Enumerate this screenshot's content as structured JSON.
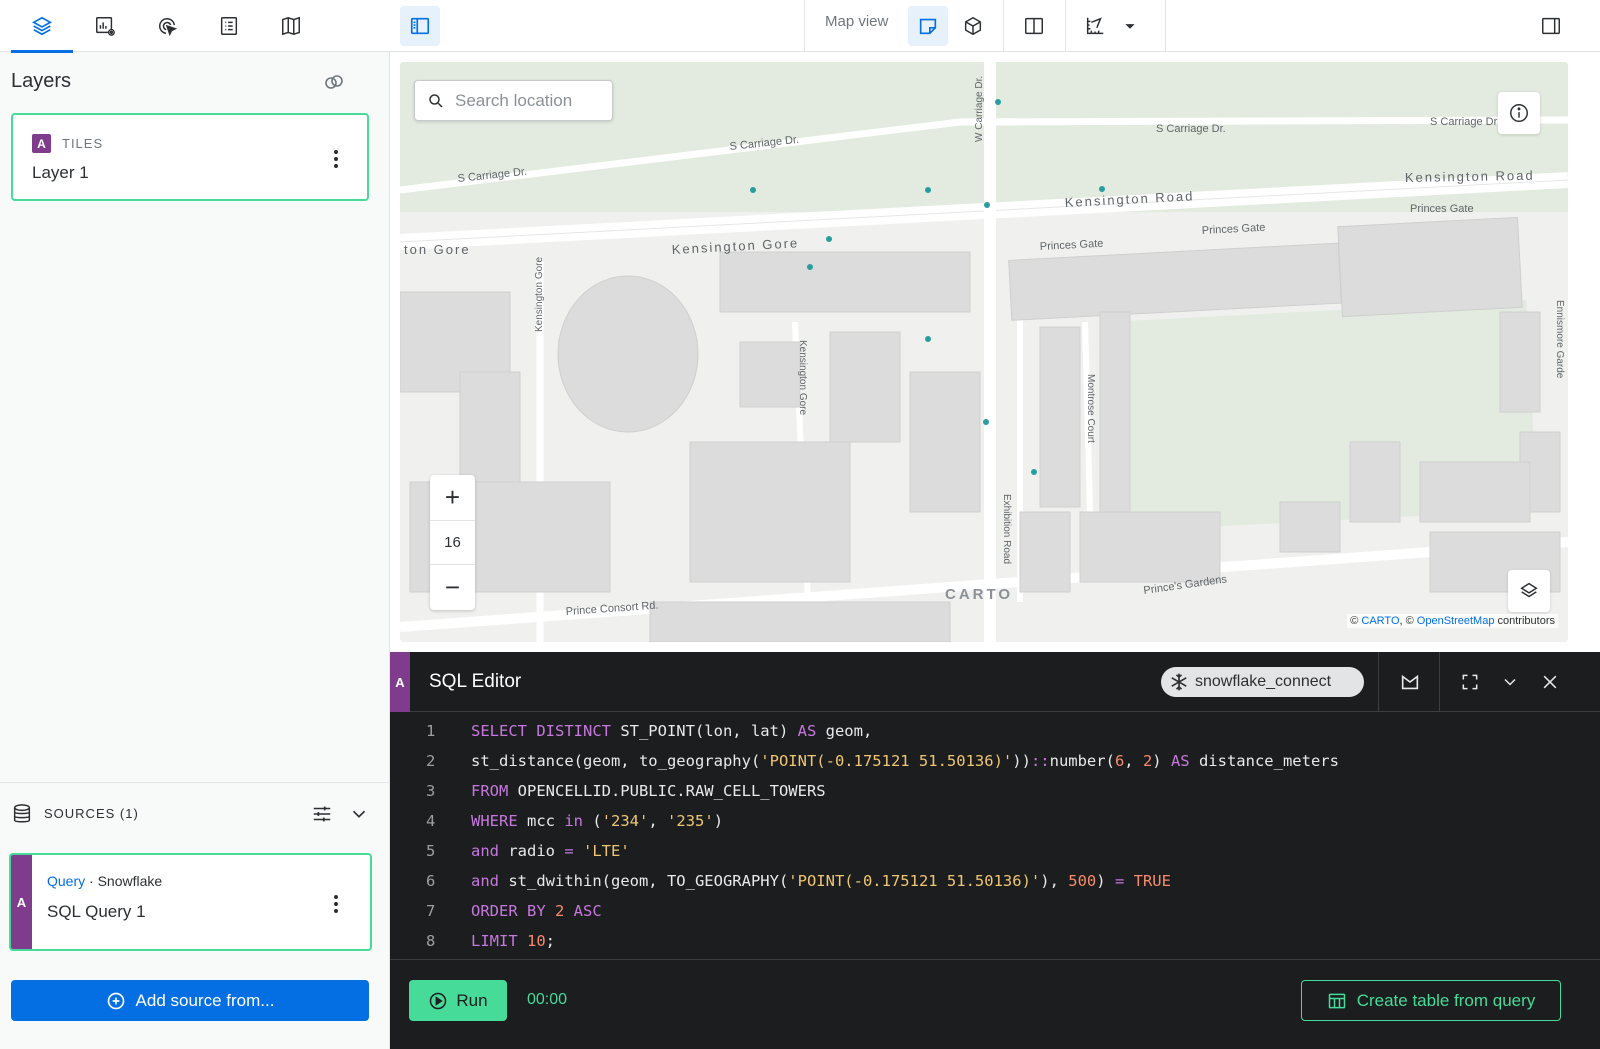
{
  "left_tabs": [
    {
      "icon": "layers-icon",
      "active": true
    },
    {
      "icon": "widgets-icon",
      "active": false
    },
    {
      "icon": "interactions-icon",
      "active": false
    },
    {
      "icon": "legend-icon",
      "active": false
    },
    {
      "icon": "basemap-icon",
      "active": false
    }
  ],
  "layers": {
    "title": "Layers",
    "items": [
      {
        "badge": "A",
        "type": "TILES",
        "name": "Layer 1"
      }
    ]
  },
  "sources": {
    "label": "SOURCES (1)",
    "items": [
      {
        "badge": "A",
        "kind": "Query",
        "separator": "·",
        "provider": "Snowflake",
        "name": "SQL Query 1"
      }
    ],
    "add_label": "Add source from..."
  },
  "toolbar": {
    "map_view_label": "Map view"
  },
  "map": {
    "search_placeholder": "Search location",
    "zoom_level": "16",
    "zoom_in": "+",
    "zoom_out": "−",
    "carto_logo": "CARTO",
    "attribution_prefix": "©",
    "attribution_carto": "CARTO",
    "attribution_sep": ", ©",
    "attribution_osm": "OpenStreetMap",
    "attribution_suffix": "contributors",
    "street_labels": {
      "kensington_road": "Kensington Road",
      "kensington_gore": "Kensington Gore",
      "kensington_gore_left": "ton Gore",
      "s_carriage_1": "S Carriage Dr.",
      "s_carriage_2": "S Carriage Dr.",
      "s_carriage_3": "S Carriage Dr.",
      "s_carriage_4": "S Carriage Dr",
      "w_carriage": "W Carriage Dr.",
      "princes_gate_1": "Princes Gate",
      "princes_gate_2": "Princes Gate",
      "princes_gate_3": "Princes Gate",
      "kensington_gore_v1": "Kensington Gore",
      "kensington_gore_v2": "Kensington Gore",
      "montrose": "Montrose Court",
      "exhibition": "Exhibition Road",
      "prince_consort": "Prince Consort Rd.",
      "princes_gardens": "Prince's Gardens",
      "ennismore": "Ennismore Garde"
    },
    "point_color": "#2a9d9f"
  },
  "editor": {
    "badge": "A",
    "title": "SQL Editor",
    "connection": "snowflake_connect",
    "lines": [
      {
        "n": "1",
        "tokens": [
          [
            "kw",
            "SELECT DISTINCT "
          ],
          [
            "pl",
            "ST_POINT(lon, lat) "
          ],
          [
            "kw",
            "AS"
          ],
          [
            "pl",
            " geom,"
          ]
        ]
      },
      {
        "n": "2",
        "tokens": [
          [
            "pl",
            "st_distance(geom, to_geography("
          ],
          [
            "str",
            "'POINT(-0.175121 51.50136)'"
          ],
          [
            "pl",
            "))"
          ],
          [
            "kw",
            "::"
          ],
          [
            "pl",
            "number("
          ],
          [
            "num",
            "6"
          ],
          [
            "pl",
            ", "
          ],
          [
            "num",
            "2"
          ],
          [
            "pl",
            ") "
          ],
          [
            "kw",
            "AS"
          ],
          [
            "pl",
            " distance_meters"
          ]
        ]
      },
      {
        "n": "3",
        "tokens": [
          [
            "kw",
            "FROM"
          ],
          [
            "pl",
            " OPENCELLID.PUBLIC.RAW_CELL_TOWERS"
          ]
        ]
      },
      {
        "n": "4",
        "tokens": [
          [
            "kw",
            "WHERE"
          ],
          [
            "pl",
            " mcc "
          ],
          [
            "kw",
            "in"
          ],
          [
            "pl",
            " ("
          ],
          [
            "str",
            "'234'"
          ],
          [
            "pl",
            ", "
          ],
          [
            "str",
            "'235'"
          ],
          [
            "pl",
            ")"
          ]
        ]
      },
      {
        "n": "5",
        "tokens": [
          [
            "kw",
            "and"
          ],
          [
            "pl",
            " radio "
          ],
          [
            "kw",
            "="
          ],
          [
            "pl",
            " "
          ],
          [
            "str",
            "'LTE'"
          ]
        ]
      },
      {
        "n": "6",
        "tokens": [
          [
            "kw",
            "and"
          ],
          [
            "pl",
            " st_dwithin(geom, TO_GEOGRAPHY("
          ],
          [
            "str",
            "'POINT(-0.175121 51.50136)'"
          ],
          [
            "pl",
            "), "
          ],
          [
            "num",
            "500"
          ],
          [
            "pl",
            ") "
          ],
          [
            "kw",
            "="
          ],
          [
            "pl",
            " "
          ],
          [
            "num",
            "TRUE"
          ]
        ]
      },
      {
        "n": "7",
        "tokens": [
          [
            "kw",
            "ORDER BY "
          ],
          [
            "num",
            "2"
          ],
          [
            "kw",
            " ASC"
          ]
        ]
      },
      {
        "n": "8",
        "tokens": [
          [
            "kw",
            "LIMIT "
          ],
          [
            "num",
            "10"
          ],
          [
            "pl",
            ";"
          ]
        ]
      }
    ],
    "run_label": "Run",
    "timer": "00:00",
    "create_label": "Create table from query"
  },
  "colors": {
    "accent": "#036fe2",
    "success": "#47db99",
    "layer_badge": "#7f3c8d",
    "editor_bg": "#1b1d1e"
  }
}
